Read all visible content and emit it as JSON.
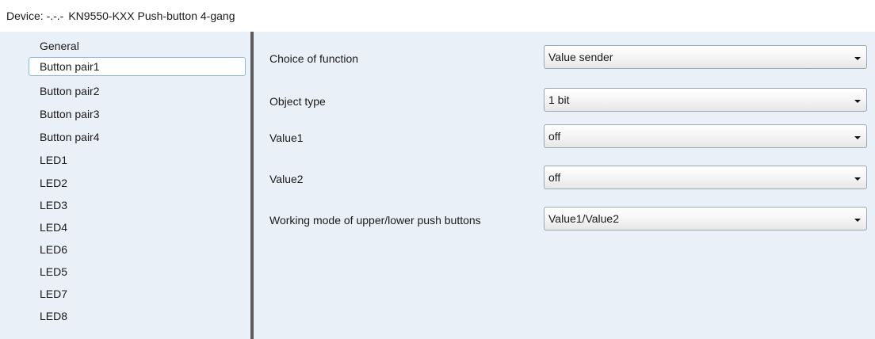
{
  "window": {
    "device_prefix": "Device: -.-.-",
    "device_name": "KN9550-KXX Push-button 4-gang"
  },
  "sidebar": {
    "items": [
      {
        "label": "General",
        "selected": false
      },
      {
        "label": "Button pair1",
        "selected": true
      },
      {
        "label": "Button pair2",
        "selected": false
      },
      {
        "label": "Button pair3",
        "selected": false
      },
      {
        "label": "Button pair4",
        "selected": false
      },
      {
        "label": "LED1",
        "selected": false
      },
      {
        "label": "LED2",
        "selected": false
      },
      {
        "label": "LED3",
        "selected": false
      },
      {
        "label": "LED4",
        "selected": false
      },
      {
        "label": "LED6",
        "selected": false
      },
      {
        "label": "LED5",
        "selected": false
      },
      {
        "label": "LED7",
        "selected": false
      },
      {
        "label": "LED8",
        "selected": false
      }
    ]
  },
  "params": [
    {
      "label": "Choice of function",
      "value": "Value sender",
      "icon": "chevron-down-icon"
    },
    {
      "label": "Object type",
      "value": "1 bit",
      "icon": "chevron-down-icon"
    },
    {
      "label": "Value1",
      "value": "off",
      "icon": "chevron-down-icon"
    },
    {
      "label": "Value2",
      "value": "off",
      "icon": "chevron-down-icon"
    },
    {
      "label": "Working mode of upper/lower push buttons",
      "value": "Value1/Value2",
      "icon": "chevron-down-icon"
    }
  ],
  "colors": {
    "panel_background": "#e9f0f7",
    "selection_border": "#90b8de",
    "splitter": "#5c5c5c"
  }
}
